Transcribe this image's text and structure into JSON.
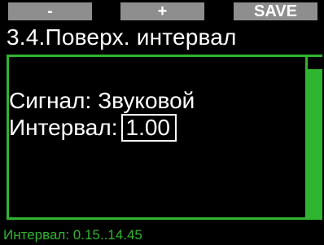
{
  "softkeys": {
    "left_label": "-",
    "middle_label": "+",
    "right_label": "SAVE"
  },
  "screen": {
    "title": "3.4.Поверх. интервал"
  },
  "settings": {
    "signal_label": "Сигнал:",
    "signal_value": "Звуковой",
    "interval_label": "Интервал:",
    "interval_value": "1.00"
  },
  "footer": {
    "hint": "Интервал: 0.15..14.45"
  },
  "colors": {
    "accent": "#2fb52f",
    "softkey_bg": "#8e8e8e",
    "background": "#000000",
    "text": "#ffffff"
  }
}
